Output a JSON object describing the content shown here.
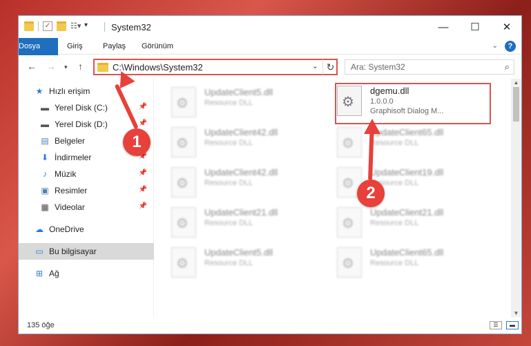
{
  "window": {
    "title": "System32"
  },
  "ribbon": {
    "tabs": [
      "Dosya",
      "Giriş",
      "Paylaş",
      "Görünüm"
    ],
    "help": "?"
  },
  "address": {
    "path": "C:\\Windows\\System32"
  },
  "search": {
    "placeholder": "Ara: System32"
  },
  "sidebar": {
    "items": [
      {
        "label": "Hızlı erişim",
        "icon": "star-icon"
      },
      {
        "label": "Yerel Disk (C:)",
        "icon": "drive-icon"
      },
      {
        "label": "Yerel Disk (D:)",
        "icon": "drive-icon"
      },
      {
        "label": "Belgeler",
        "icon": "document-icon"
      },
      {
        "label": "İndirmeler",
        "icon": "download-icon"
      },
      {
        "label": "Müzik",
        "icon": "music-icon"
      },
      {
        "label": "Resimler",
        "icon": "pictures-icon"
      },
      {
        "label": "Videolar",
        "icon": "video-icon"
      },
      {
        "label": "OneDrive",
        "icon": "cloud-icon"
      },
      {
        "label": "Bu bilgisayar",
        "icon": "computer-icon"
      },
      {
        "label": "Ağ",
        "icon": "network-icon"
      }
    ]
  },
  "files": {
    "highlighted": {
      "name": "dgemu.dll",
      "version": "1.0.0.0",
      "description": "Graphisoft Dialog M..."
    },
    "blurred": [
      {
        "name": "UpdateClient5.dll",
        "type": "Resource DLL"
      },
      {
        "name": "UpdateClient42.dll",
        "type": "Resource DLL"
      },
      {
        "name": "UpdateClient65.dll",
        "type": "Resource DLL"
      },
      {
        "name": "UpdateClient42.dll",
        "type": "Resource DLL"
      },
      {
        "name": "UpdateClient19.dll",
        "type": "Resource DLL"
      },
      {
        "name": "UpdateClient21.dll",
        "type": "Resource DLL"
      },
      {
        "name": "UpdateClient21.dll",
        "type": "Resource DLL"
      },
      {
        "name": "UpdateClient5.dll",
        "type": "Resource DLL"
      },
      {
        "name": "UpdateClient65.dll",
        "type": "Resource DLL"
      }
    ]
  },
  "status": {
    "count": "135 öğe"
  },
  "annotations": {
    "badge1": "1",
    "badge2": "2"
  }
}
